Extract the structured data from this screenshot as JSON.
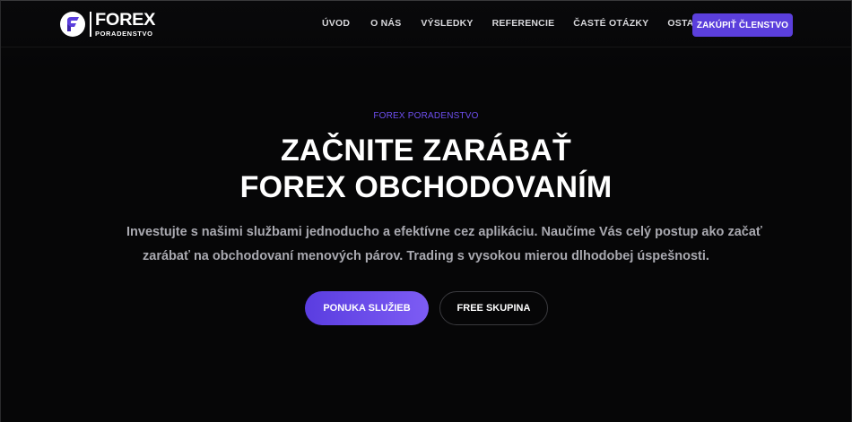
{
  "brand": {
    "logo_text": "FOREX",
    "logo_subtext": "PORADENSTVO"
  },
  "nav": {
    "items": [
      {
        "label": "ÚVOD"
      },
      {
        "label": "O NÁS"
      },
      {
        "label": "VÝSLEDKY"
      },
      {
        "label": "REFERENCIE"
      },
      {
        "label": "ČASTÉ OTÁZKY"
      },
      {
        "label": "OSTATNÉ"
      }
    ],
    "cta_label": "ZAKÚPIŤ ČLENSTVO"
  },
  "hero": {
    "eyebrow": "FOREX PORADENSTVO",
    "headline_line1": "ZAČNITE ZARÁBAŤ",
    "headline_line2": "FOREX OBCHODOVANÍM",
    "lead_line1": "Investujte s našimi službami jednoducho a efektívne cez aplikáciu. Naučíme Vás celý postup ako začať",
    "lead_line2": "zarábať na obchodovaní menových párov. Trading s vysokou mierou dlhodobej úspešnosti.",
    "primary_button": "PONUKA SLUŽIEB",
    "secondary_button": "FREE SKUPINA"
  },
  "colors": {
    "background": "#060607",
    "accent": "#5b3fdc",
    "eyebrow": "#6e4ff0",
    "lead_text": "#a9a9b0"
  }
}
